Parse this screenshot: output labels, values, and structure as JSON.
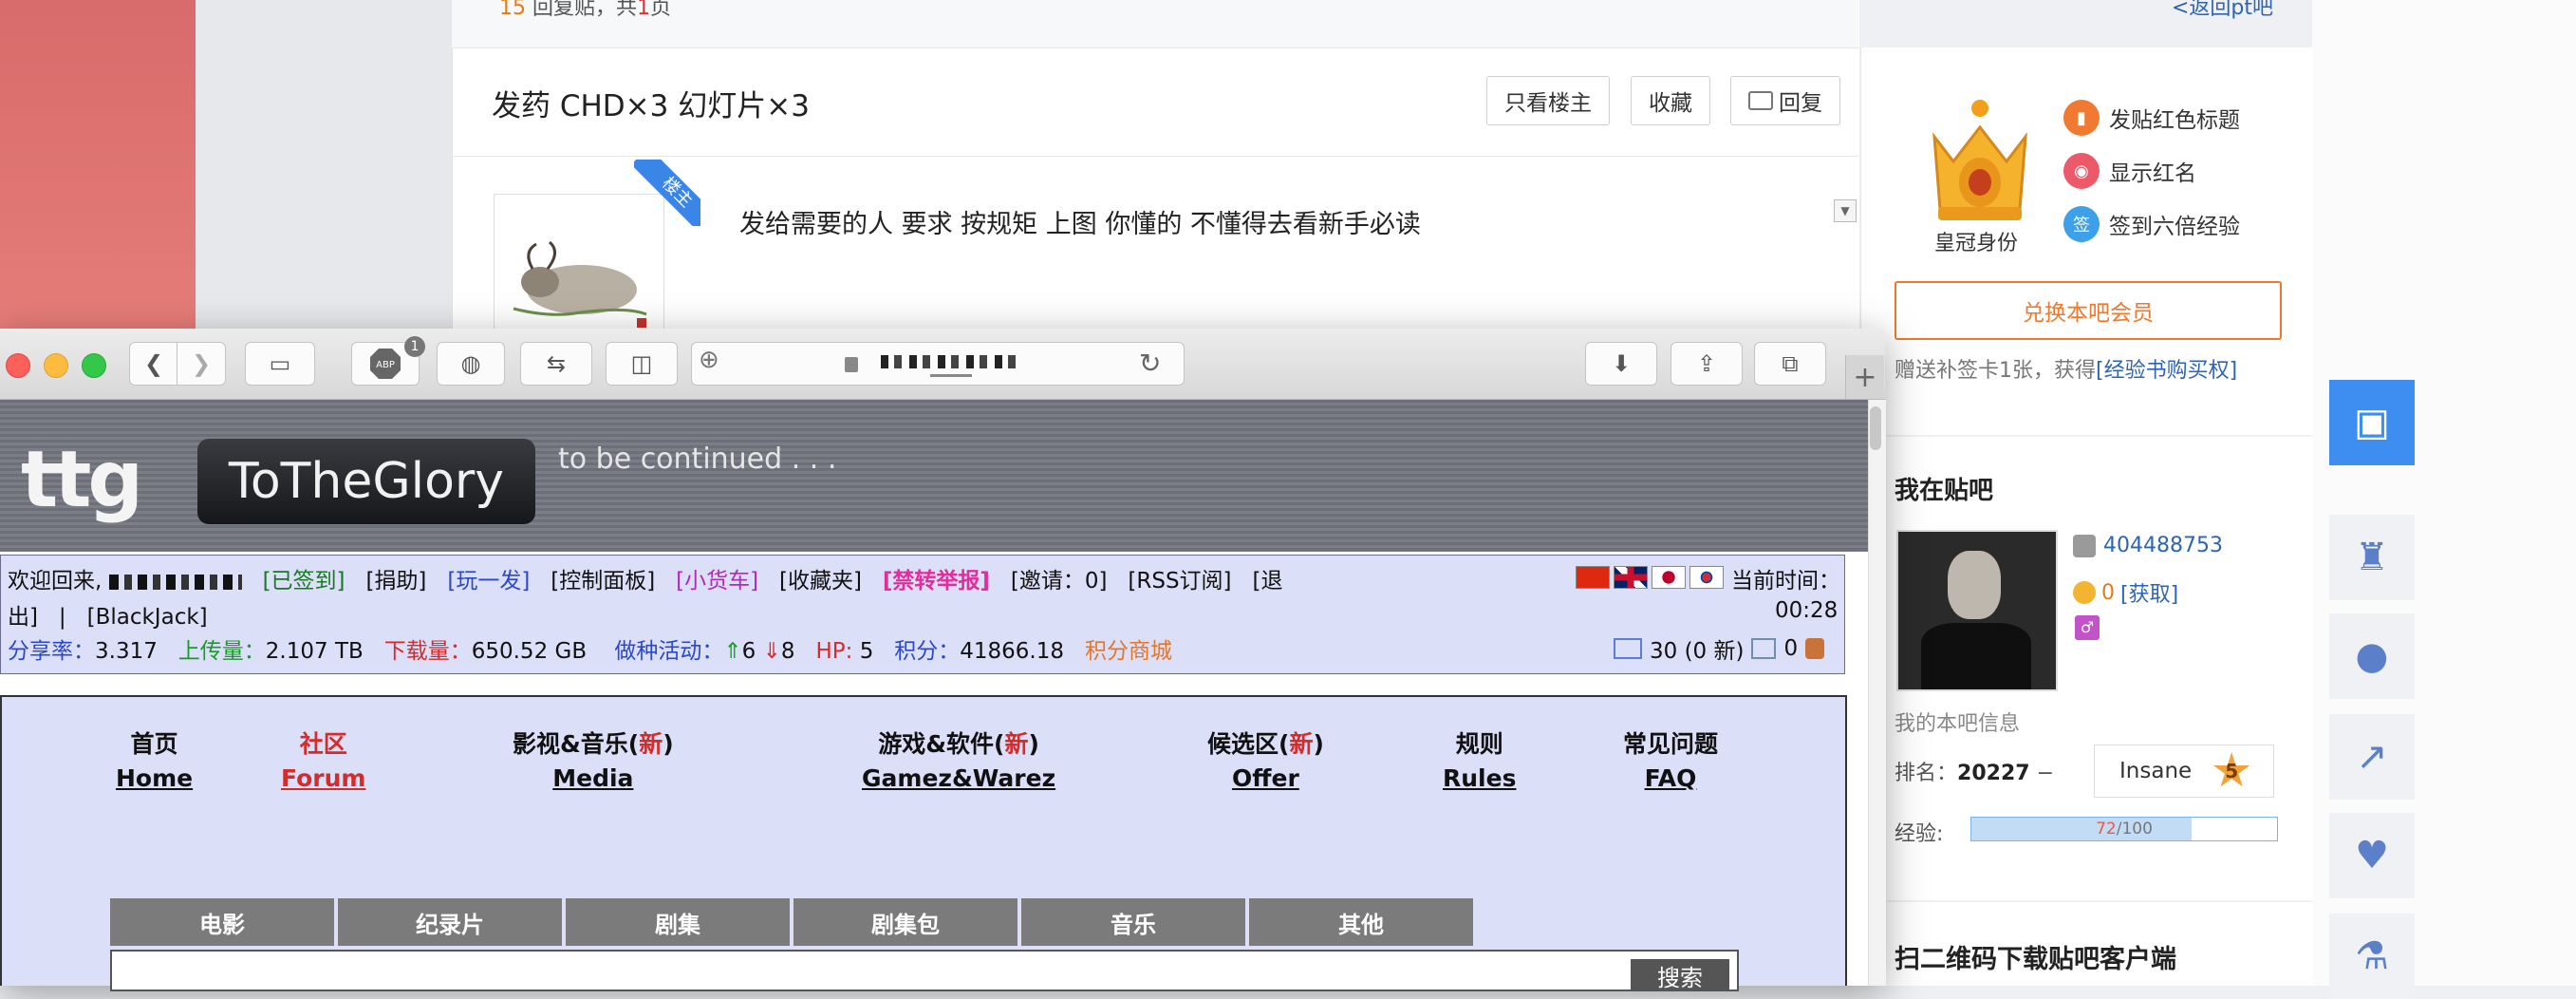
{
  "forum": {
    "reply_count_num": "15",
    "reply_count_mid": " 回复贴，共",
    "reply_count_page": "1",
    "reply_count_end": "页",
    "back_link": "<返回pt吧",
    "post_title": "发药 CHD×3 幻灯片×3",
    "buttons": {
      "only_op": "只看楼主",
      "favorite": "收藏",
      "reply": "回复"
    },
    "op_ribbon": "楼主",
    "post_text": "发给需要的人 要求 按规矩 上图 你懂的 不懂得去看新手必读"
  },
  "sidebar": {
    "crown_label": "皇冠身份",
    "perks": [
      {
        "icon": "bookmark-icon",
        "label": "发贴红色标题"
      },
      {
        "icon": "eye-icon",
        "label": "显示红名"
      },
      {
        "icon": "sign-icon",
        "label": "签到六倍经验",
        "glyph": "签"
      }
    ],
    "redeem_button": "兑换本吧会员",
    "bonus_prefix": "赠送补签卡1张，获得",
    "bonus_link": "[经验书购买权]",
    "my_bar_title": "我在贴吧",
    "user_id": "404488753",
    "coin_text": "0",
    "coin_link": "[获取]",
    "my_info": "我的本吧信息",
    "rank_label": "排名：",
    "rank_value": "20227",
    "rank_trend": "−",
    "level_name": "Insane",
    "level_num": "5",
    "exp_label": "经验:",
    "exp_current": "72",
    "exp_total": "/100",
    "exp_fraction": 0.72,
    "qr_title": "扫二维码下载贴吧客户端"
  },
  "tools": [
    "chat-icon",
    "hat-icon",
    "bear-icon",
    "share-icon",
    "heart-icon",
    "flask-icon"
  ],
  "safari": {
    "abp_label": "ABP",
    "abp_badge": "1"
  },
  "site": {
    "logo_short": "ttg",
    "logo_name": "ToTheGlory",
    "tagline": "to be continued . . .",
    "welcome": "欢迎回来,",
    "signed": "[已签到]",
    "donate": "[捐助]",
    "play": "[玩一发]",
    "control": "[控制面板]",
    "cart": "[小货车]",
    "favorites": "[收藏夹]",
    "report": "[禁转举报]",
    "invite": "[邀请：0]",
    "rss": "[RSS订阅]",
    "logout_a": "[退",
    "logout_b": "出]",
    "sep": "|",
    "blackjack": "[BlackJack]",
    "share_ratio_label": "分享率：",
    "share_ratio": "3.317",
    "upload_label": "上传量：",
    "upload": "2.107 TB",
    "download_label": "下载量：",
    "download": "650.52 GB",
    "seeding_label": "做种活动：",
    "seeding_up": "6",
    "seeding_down": "8",
    "hp_label": "HP: ",
    "hp": "5",
    "points_label": "积分：",
    "points": "41866.18",
    "shop": "积分商城",
    "time_label": "当前时间：",
    "time": "00:28",
    "messages": "30 (0 新)",
    "msg_other": "0",
    "menu": [
      {
        "zh": "首页",
        "en": "Home"
      },
      {
        "zh": "社区",
        "en": "Forum"
      },
      {
        "zh": "影视&音乐(",
        "new": "新",
        "close": ")",
        "en": "Media"
      },
      {
        "zh": "游戏&软件(",
        "new": "新",
        "close": ")",
        "en": "Gamez&Warez"
      },
      {
        "zh": "候选区(",
        "new": "新",
        "close": ")",
        "en": "Offer"
      },
      {
        "zh": "规则",
        "en": "Rules"
      },
      {
        "zh": "常见问题",
        "en": "FAQ"
      }
    ],
    "categories": [
      "电影",
      "纪录片",
      "剧集",
      "剧集包",
      "音乐",
      "其他"
    ],
    "search_button": "搜索"
  }
}
